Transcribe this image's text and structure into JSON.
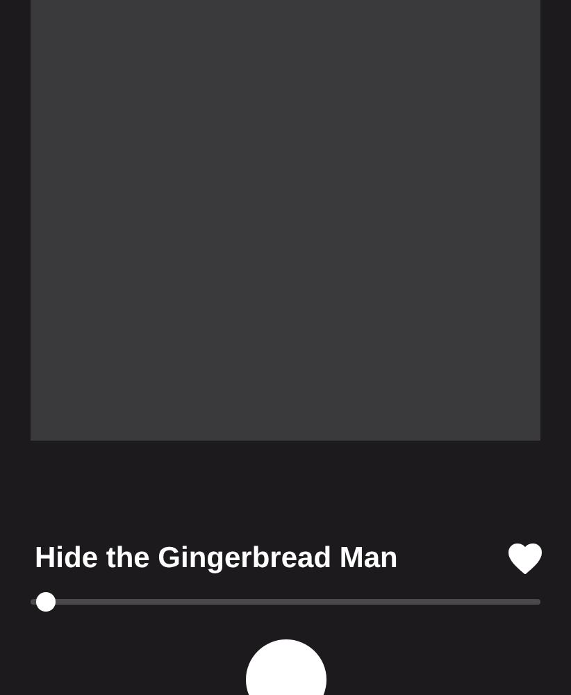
{
  "track": {
    "title": "Hide the Gingerbread Man",
    "favorite": true
  },
  "progress": {
    "level": 0.02
  }
}
